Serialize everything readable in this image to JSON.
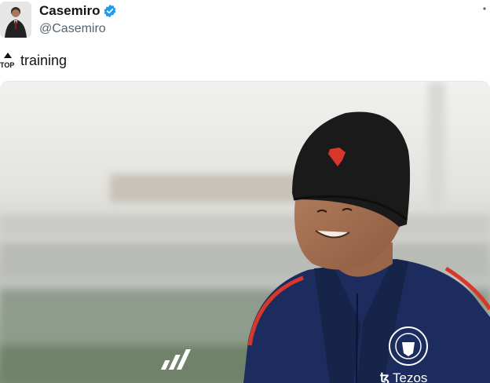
{
  "tweet": {
    "author": {
      "display_name": "Casemiro",
      "handle": "@Casemiro",
      "verified": true,
      "verified_icon": "verified-badge-icon",
      "avatar": "avatar"
    },
    "text_icon": "top-emoji-icon",
    "text_icon_label": "TOP",
    "text": "training",
    "more_icon": "more-options-icon",
    "media": {
      "description_icon": "photo",
      "sponsor_text": "Tezos",
      "brand_icon": "adidas-logo-icon",
      "crest_icon": "club-crest-icon"
    }
  },
  "colors": {
    "verified": "#1d9bf0",
    "handle": "#536471",
    "jacket": "#1c2c5e",
    "beanie": "#1a1a1a",
    "accent_red": "#d8382c"
  }
}
